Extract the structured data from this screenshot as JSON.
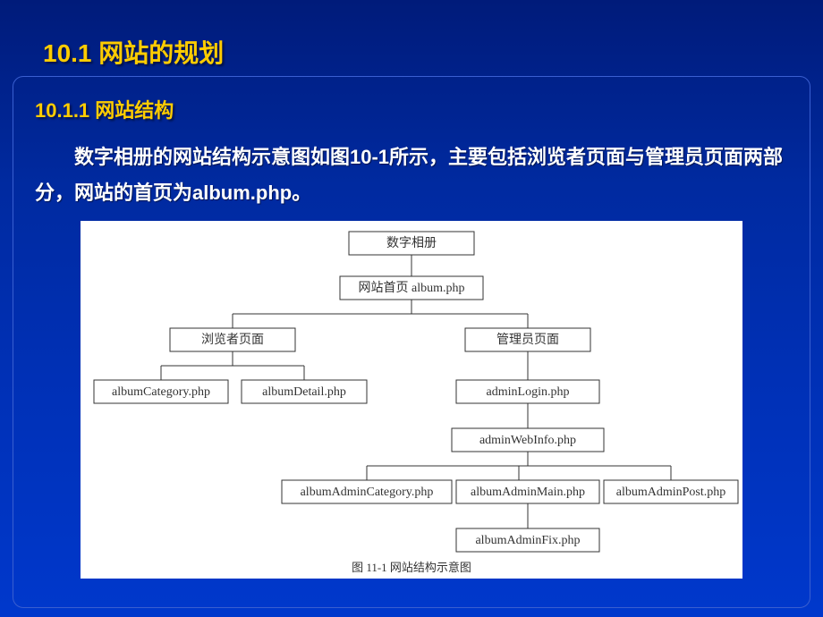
{
  "headings": {
    "section": "10.1  网站的规划",
    "subsection": "10.1.1  网站结构"
  },
  "paragraph": "数字相册的网站结构示意图如图10-1所示，主要包括浏览者页面与管理员页面两部分，网站的首页为album.php。",
  "chart_data": {
    "type": "tree",
    "caption": "图 11-1    网站结构示意图",
    "nodes": {
      "root": "数字相册",
      "homepage": "网站首页 album.php",
      "viewer": "浏览者页面",
      "admin": "管理员页面",
      "albumCategory": "albumCategory.php",
      "albumDetail": "albumDetail.php",
      "adminLogin": "adminLogin.php",
      "adminWebInfo": "adminWebInfo.php",
      "albumAdminCategory": "albumAdminCategory.php",
      "albumAdminMain": "albumAdminMain.php",
      "albumAdminPost": "albumAdminPost.php",
      "albumAdminFix": "albumAdminFix.php"
    },
    "edges": [
      [
        "root",
        "homepage"
      ],
      [
        "homepage",
        "viewer"
      ],
      [
        "homepage",
        "admin"
      ],
      [
        "viewer",
        "albumCategory"
      ],
      [
        "viewer",
        "albumDetail"
      ],
      [
        "admin",
        "adminLogin"
      ],
      [
        "adminLogin",
        "adminWebInfo"
      ],
      [
        "adminWebInfo",
        "albumAdminCategory"
      ],
      [
        "adminWebInfo",
        "albumAdminMain"
      ],
      [
        "adminWebInfo",
        "albumAdminPost"
      ],
      [
        "albumAdminMain",
        "albumAdminFix"
      ]
    ]
  }
}
